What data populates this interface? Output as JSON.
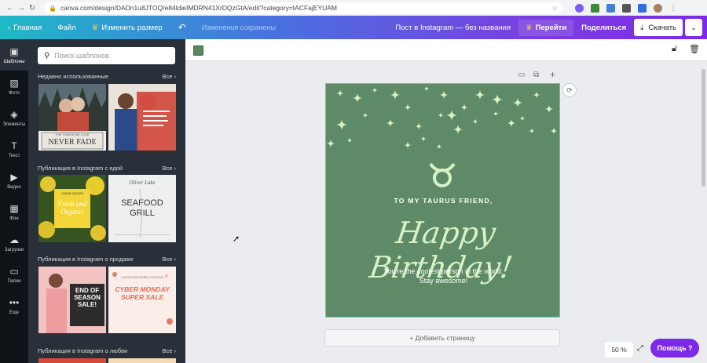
{
  "browser": {
    "back": "←",
    "forward": "→",
    "reload": "C",
    "url": "canva.com/design/DADn1u8JTOQ/e84ldieIMDRN41XrDQzGtA/edit?category=tACFajEYUAM"
  },
  "topbar": {
    "home": "Главная",
    "file": "Файл",
    "resize": "Изменить размер",
    "saved": "Изменения сохранены",
    "doc_title": "Пост в Instagram — без названия",
    "go": "Перейти",
    "share": "Поделиться",
    "download": "Скачать"
  },
  "rail": [
    {
      "icon": "templates-icon",
      "label": "Шаблоны"
    },
    {
      "icon": "photo-icon",
      "label": "Фото"
    },
    {
      "icon": "elements-icon",
      "label": "Элементы"
    },
    {
      "icon": "text-icon",
      "label": "Текст"
    },
    {
      "icon": "video-icon",
      "label": "Видео"
    },
    {
      "icon": "background-icon",
      "label": "Фон"
    },
    {
      "icon": "upload-icon",
      "label": "Загрузки"
    },
    {
      "icon": "folder-icon",
      "label": "Папки"
    },
    {
      "icon": "more-icon",
      "label": "Еще"
    }
  ],
  "panel": {
    "search_placeholder": "Поиск шаблонов",
    "all_label": "Все",
    "sections": [
      {
        "title": "Недавно использованные"
      },
      {
        "title": "Публикация в Instagram с едой"
      },
      {
        "title": "Публикация в Instagram о продаже"
      },
      {
        "title": "Публикация в Instagram о любви"
      }
    ],
    "thumbs": {
      "never_fade": "NEVER FADE",
      "never_fade_sub": "THE THINGS WE LOVE",
      "fresh": "Fresh and Organic",
      "fresh_top": "LEMON SQUASH",
      "seafood_top": "Oliver Lake",
      "seafood": "SEAFOOD GRILL",
      "sale": "END OF SEASON SALE!",
      "cyber": "CYBER MONDAY SUPER SALE",
      "cyber_top": "LONGCOURT MOBILE SYSTEMS"
    }
  },
  "card": {
    "line1": "TO MY TAURUS FRIEND,",
    "headline": "Happy Birthday!",
    "line2": "You're the coolest person in the world.",
    "line3": "Stay awesome!",
    "bg_color": "#5e8a67",
    "accent_color": "#d7f2c4"
  },
  "workspace": {
    "add_page": "+ Добавить страницу",
    "zoom": "50 %",
    "help": "Помощь ?"
  }
}
